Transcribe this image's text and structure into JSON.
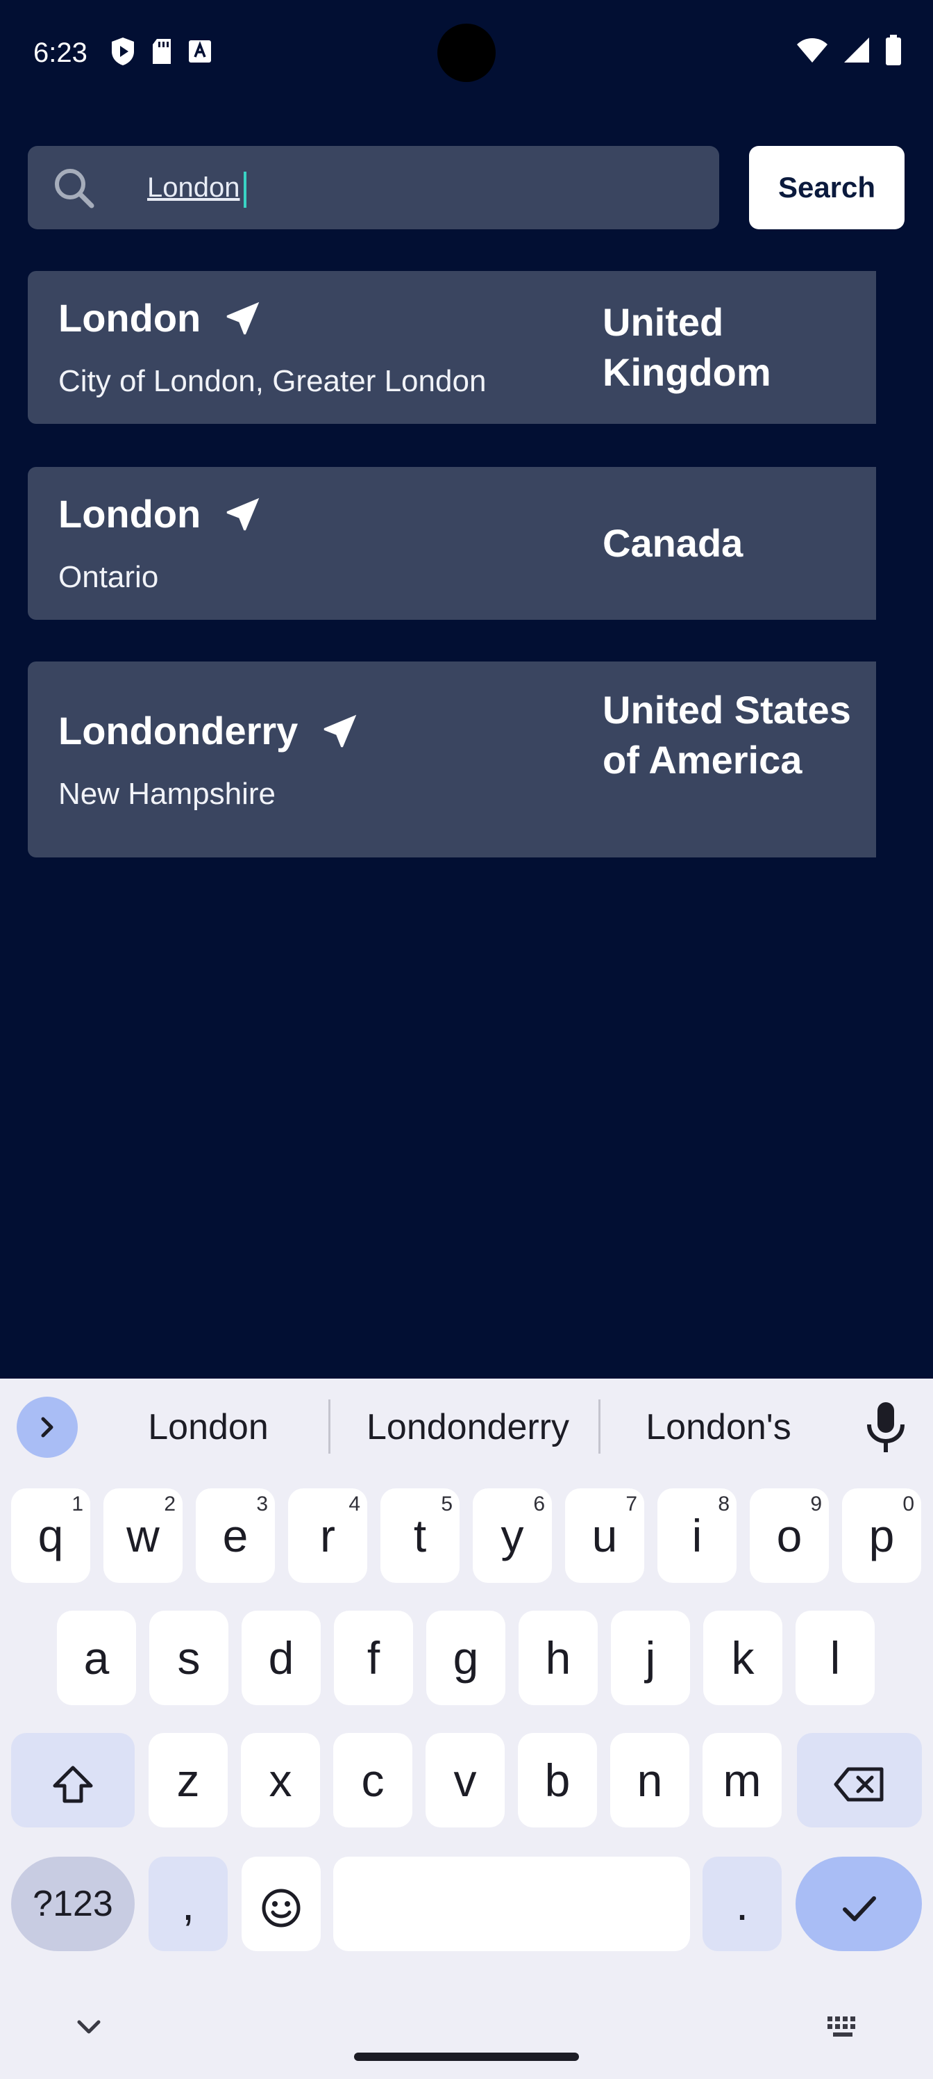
{
  "status_bar": {
    "time": "6:23"
  },
  "search": {
    "value": "London",
    "button_label": "Search"
  },
  "results": [
    {
      "name": "London",
      "region": "City of London, Greater London",
      "country": "United Kingdom"
    },
    {
      "name": "London",
      "region": "Ontario",
      "country": "Canada"
    },
    {
      "name": "Londonderry",
      "region": "New Hampshire",
      "country": "United States of America"
    }
  ],
  "keyboard": {
    "suggestions": [
      "London",
      "Londonderry",
      "London's"
    ],
    "row1": [
      {
        "key": "q",
        "hint": "1"
      },
      {
        "key": "w",
        "hint": "2"
      },
      {
        "key": "e",
        "hint": "3"
      },
      {
        "key": "r",
        "hint": "4"
      },
      {
        "key": "t",
        "hint": "5"
      },
      {
        "key": "y",
        "hint": "6"
      },
      {
        "key": "u",
        "hint": "7"
      },
      {
        "key": "i",
        "hint": "8"
      },
      {
        "key": "o",
        "hint": "9"
      },
      {
        "key": "p",
        "hint": "0"
      }
    ],
    "row2": [
      "a",
      "s",
      "d",
      "f",
      "g",
      "h",
      "j",
      "k",
      "l"
    ],
    "row3": [
      "z",
      "x",
      "c",
      "v",
      "b",
      "n",
      "m"
    ],
    "symbols_label": "?123",
    "comma": ",",
    "period": "."
  },
  "colors": {
    "background": "#020f33",
    "card": "#3a4560",
    "keyboard": "#eeeef6",
    "accent": "#a9bdf5",
    "cursor": "#39d3c4"
  }
}
